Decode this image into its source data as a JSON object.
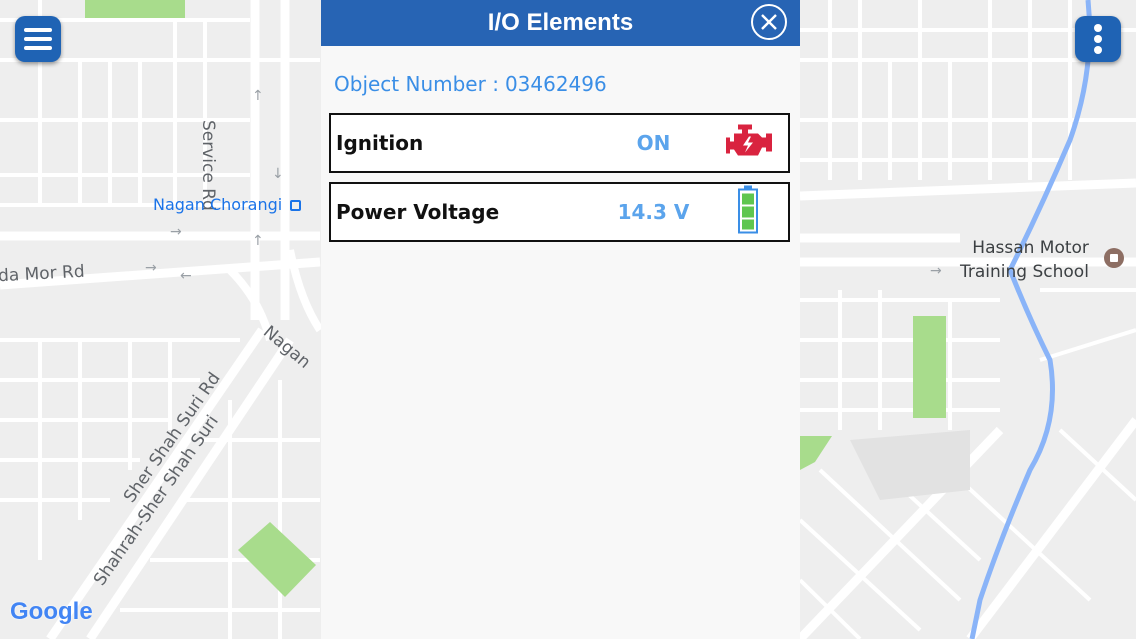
{
  "map": {
    "labels": {
      "service_rd": "Service Rd",
      "nagan_chorangi": "Nagan Chorangi",
      "da_mor_rd": "da Mor Rd",
      "nagan": "Nagan",
      "sher_shah_suri_rd": "Sher Shah Suri Rd",
      "shahrah_sher_shah_suri": "Shahrah-Sher Shah Suri",
      "hassan_motor_line1": "Hassan Motor",
      "hassan_motor_line2": "Training School"
    },
    "attribution": "Google",
    "colors": {
      "background": "#eeeeee",
      "road": "#ffffff",
      "park": "#a8dc8c",
      "river": "#8ab4f8"
    }
  },
  "controls": {
    "menu_icon": "hamburger-menu-icon",
    "more_icon": "vertical-dots-icon",
    "accent": "#1f63b4"
  },
  "panel": {
    "title": "I/O Elements",
    "close_icon": "close-circle-icon",
    "object_label": "Object Number :",
    "object_number": "03462496",
    "items": [
      {
        "label": "Ignition",
        "value": "ON",
        "icon": "engine-icon",
        "icon_color": "#d9233f"
      },
      {
        "label": "Power Voltage",
        "value": "14.3 V",
        "icon": "battery-full-icon",
        "icon_color": "#5fc64f"
      }
    ],
    "colors": {
      "header": "#2764b4",
      "value": "#5ba4ec",
      "object": "#3a8ee6"
    }
  }
}
